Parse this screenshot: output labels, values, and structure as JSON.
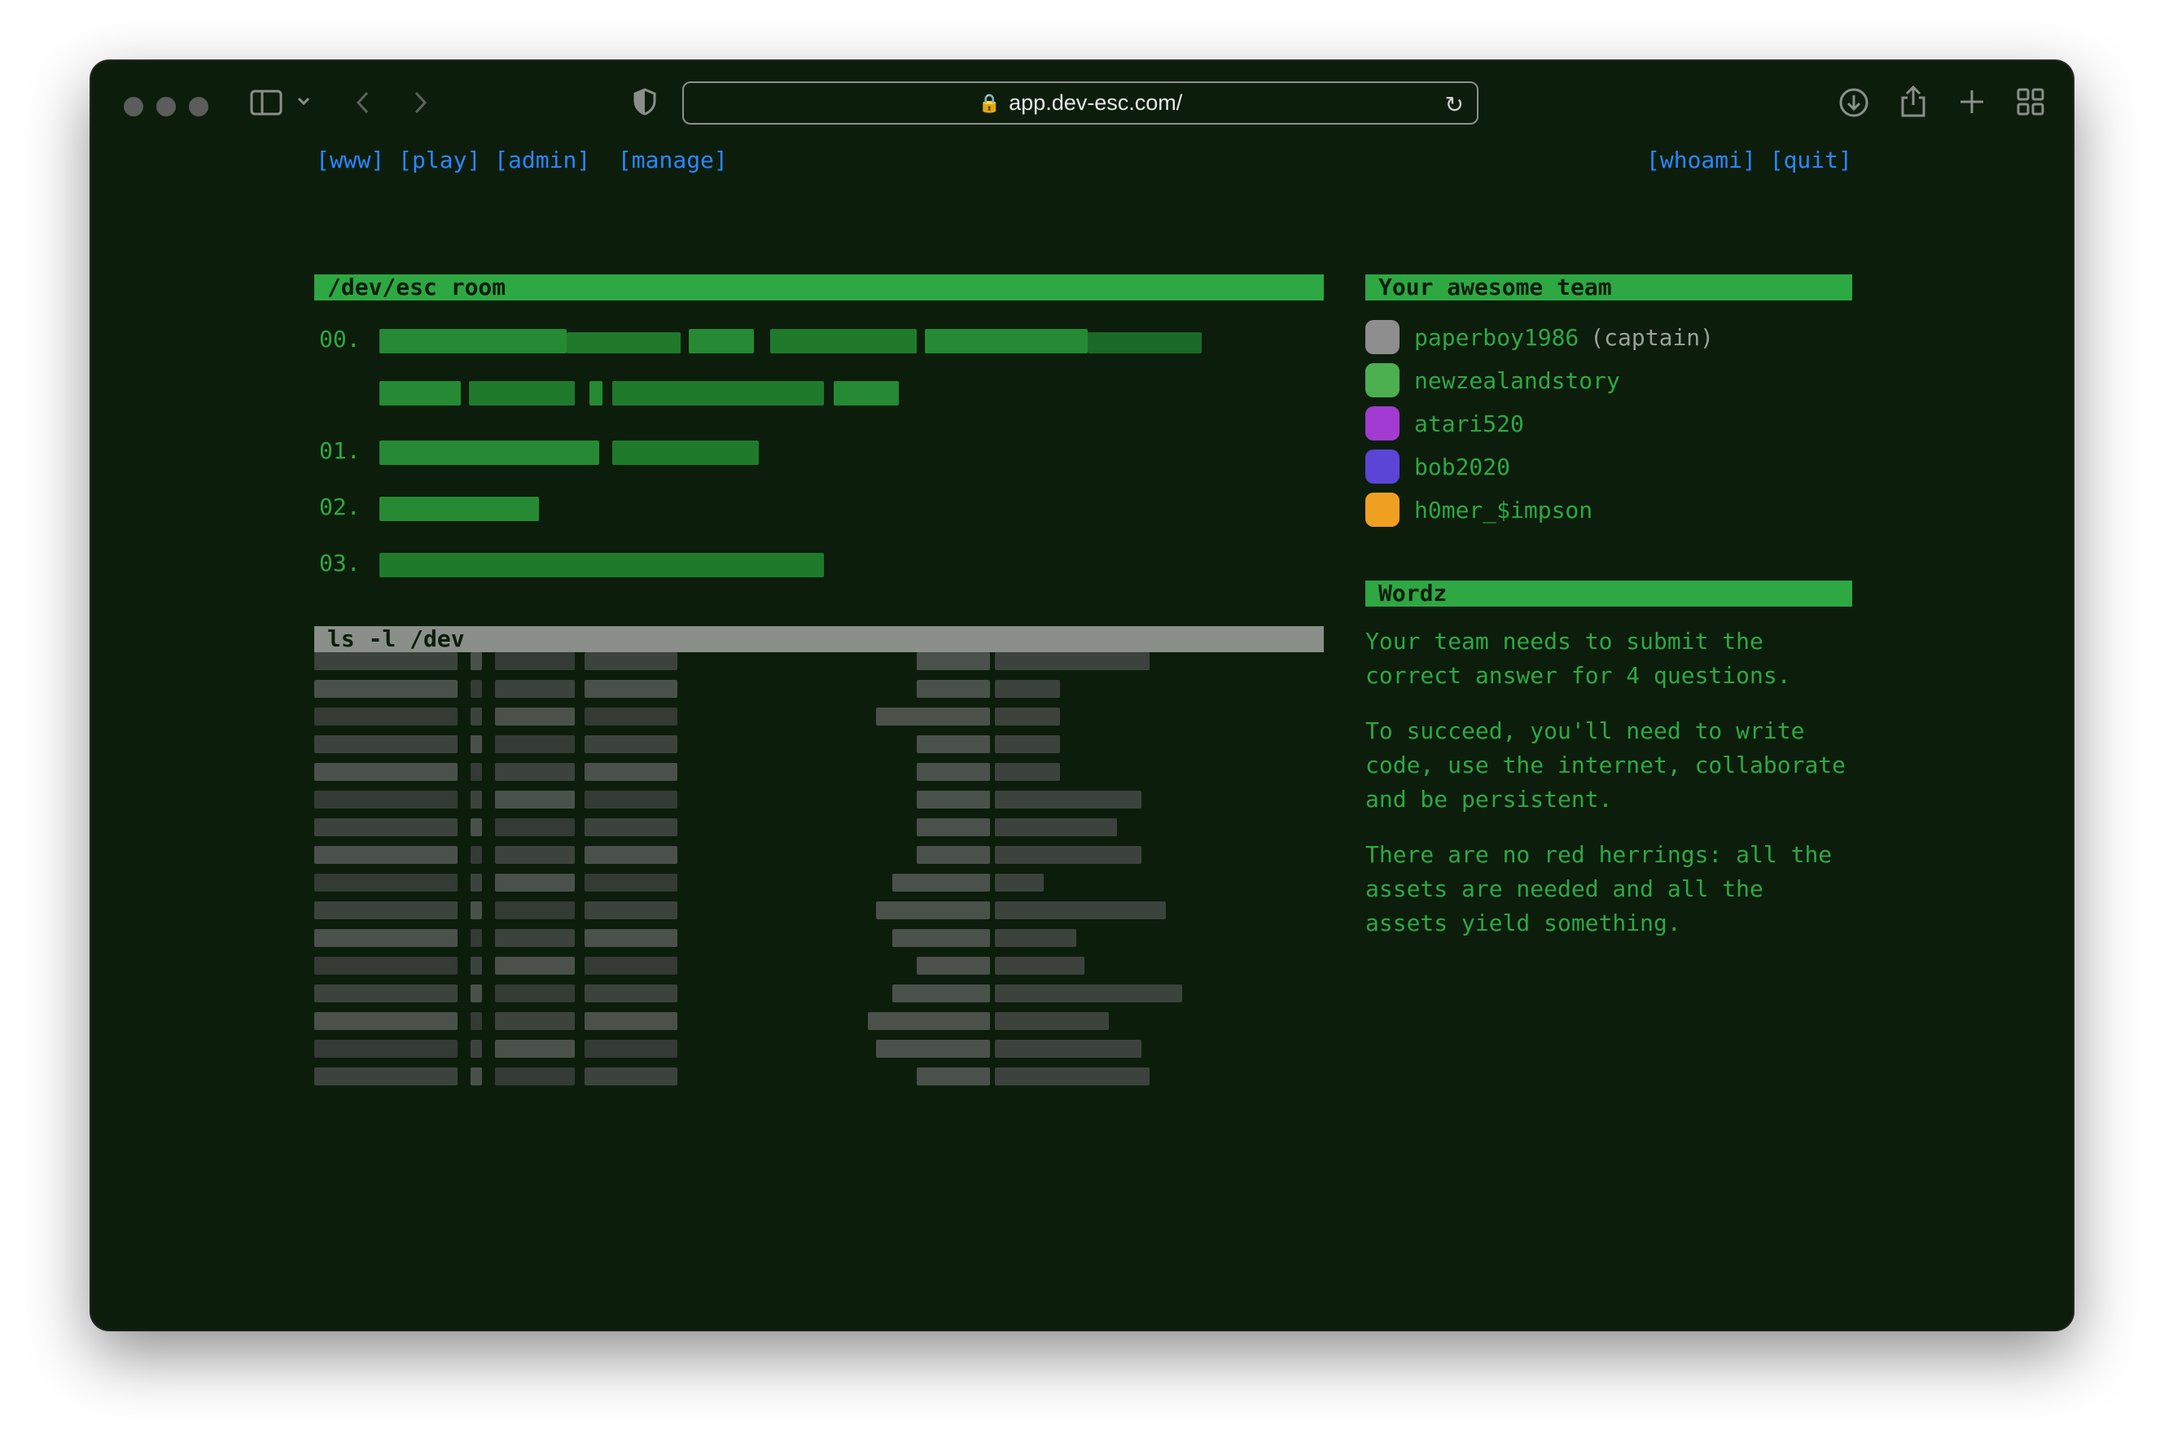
{
  "browser": {
    "url": "app.dev-esc.com/"
  },
  "nav": {
    "left": [
      "[www]",
      "[play]",
      "[admin]",
      "[manage]"
    ],
    "right": [
      "[whoami]",
      "[quit]"
    ]
  },
  "room": {
    "title": "/dev/esc room",
    "questions": [
      "00.",
      "01.",
      "02.",
      "03."
    ]
  },
  "listing": {
    "title": "ls -l /dev"
  },
  "team": {
    "title": "Your awesome team",
    "members": [
      {
        "name": "paperboy1986",
        "role": "(captain)",
        "avatar_color": "#8e8e8e"
      },
      {
        "name": "newzealandstory",
        "role": "",
        "avatar_color": "#4caf50"
      },
      {
        "name": "atari520",
        "role": "",
        "avatar_color": "#a23bd1"
      },
      {
        "name": "bob2020",
        "role": "",
        "avatar_color": "#5b45d6"
      },
      {
        "name": "h0mer_$impson",
        "role": "",
        "avatar_color": "#f0a020"
      }
    ]
  },
  "wordz": {
    "title": "Wordz",
    "paragraphs": [
      "Your team needs to submit the correct answer for 4 questions.",
      "To succeed, you'll need to write code, use the internet, collaborate and be persistent.",
      "There are no red herrings: all the assets are needed and all the assets yield something."
    ]
  },
  "colors": {
    "background": "#0c1d0c",
    "accent_green": "#2ea843",
    "link_blue": "#2a86ff"
  }
}
